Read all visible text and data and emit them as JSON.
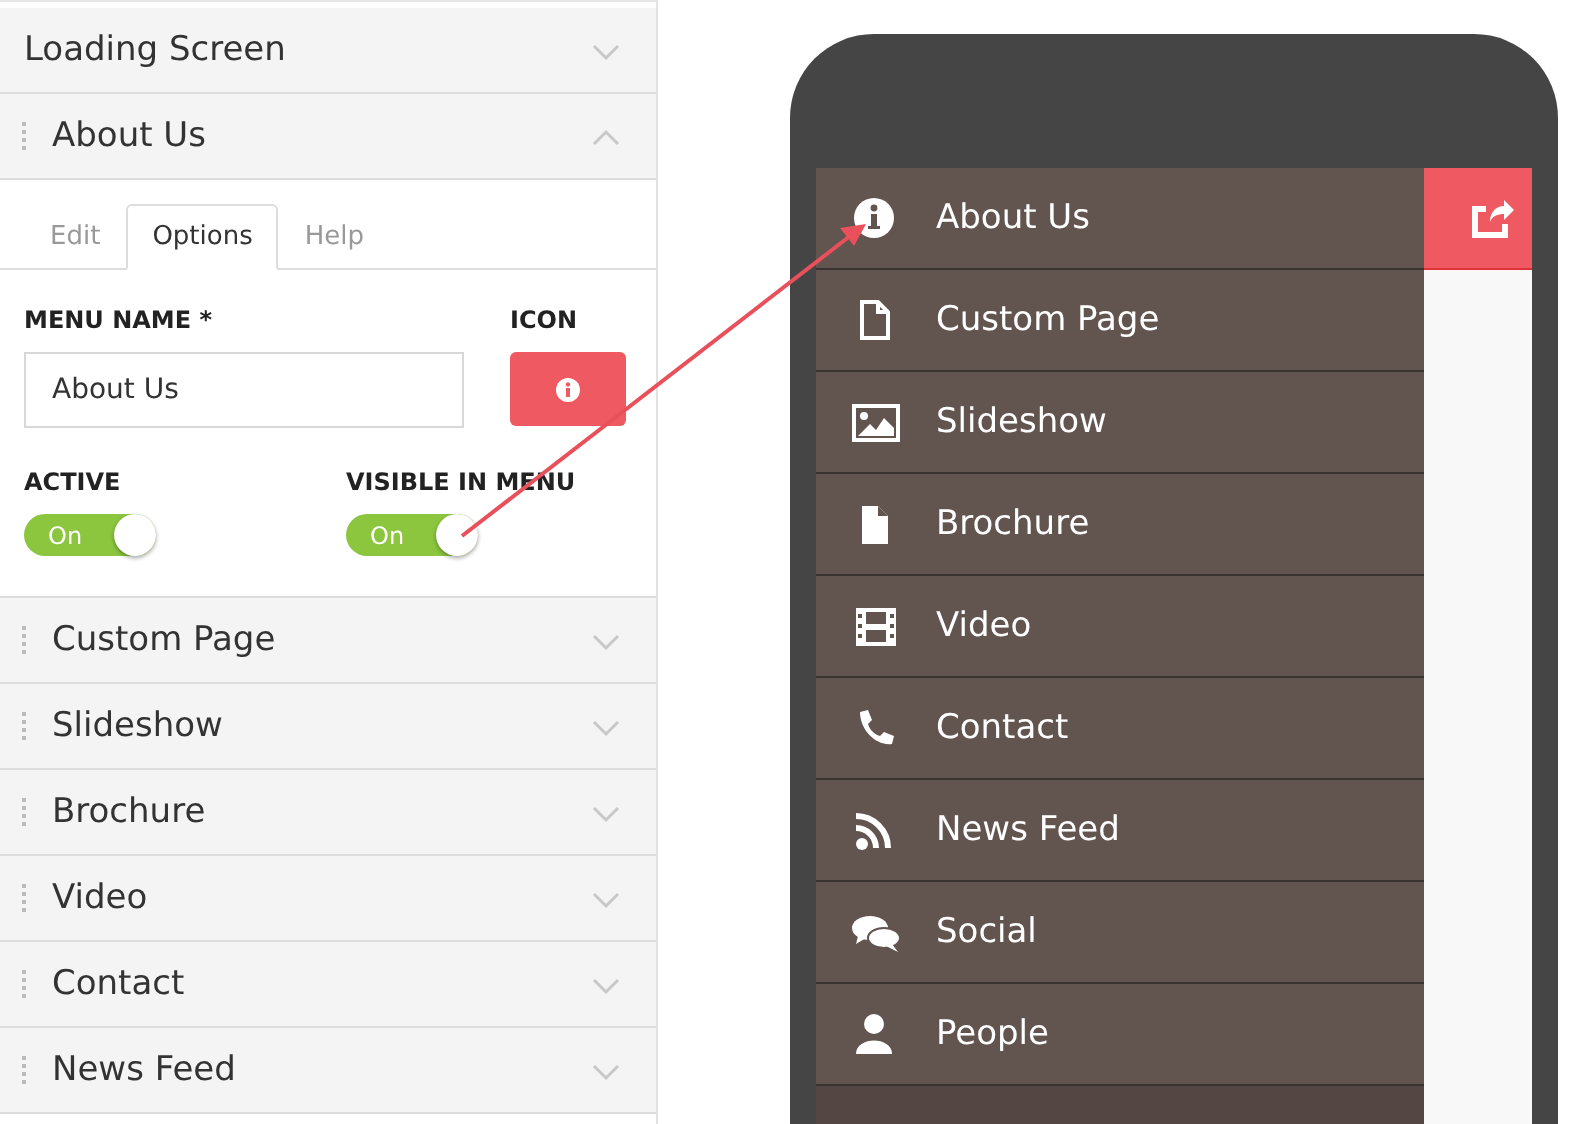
{
  "sections_top": [
    {
      "label": "Loading Screen",
      "handle": false,
      "expanded": false
    },
    {
      "label": "About Us",
      "handle": true,
      "expanded": true
    }
  ],
  "editor": {
    "tabs": [
      {
        "label": "Edit",
        "selected": false
      },
      {
        "label": "Options",
        "selected": true
      },
      {
        "label": "Help",
        "selected": false
      }
    ],
    "menu_name_label": "MENU NAME *",
    "menu_name_value": "About Us",
    "icon_label": "ICON",
    "toggles": [
      {
        "label": "ACTIVE",
        "text": "On",
        "on": true
      },
      {
        "label": "VISIBLE IN MENU",
        "text": "On",
        "on": true
      }
    ]
  },
  "sections_bottom": [
    {
      "label": "Custom Page",
      "handle": true,
      "expanded": false
    },
    {
      "label": "Slideshow",
      "handle": true,
      "expanded": false
    },
    {
      "label": "Brochure",
      "handle": true,
      "expanded": false
    },
    {
      "label": "Video",
      "handle": true,
      "expanded": false
    },
    {
      "label": "Contact",
      "handle": true,
      "expanded": false
    },
    {
      "label": "News Feed",
      "handle": true,
      "expanded": false
    }
  ],
  "phone_menu": [
    {
      "label": "About Us",
      "kind": "info"
    },
    {
      "label": "Custom Page",
      "kind": "page"
    },
    {
      "label": "Slideshow",
      "kind": "picture"
    },
    {
      "label": "Brochure",
      "kind": "file"
    },
    {
      "label": "Video",
      "kind": "film"
    },
    {
      "label": "Contact",
      "kind": "phone"
    },
    {
      "label": "News Feed",
      "kind": "rss"
    },
    {
      "label": "Social",
      "kind": "chat"
    },
    {
      "label": "People",
      "kind": "person"
    }
  ]
}
